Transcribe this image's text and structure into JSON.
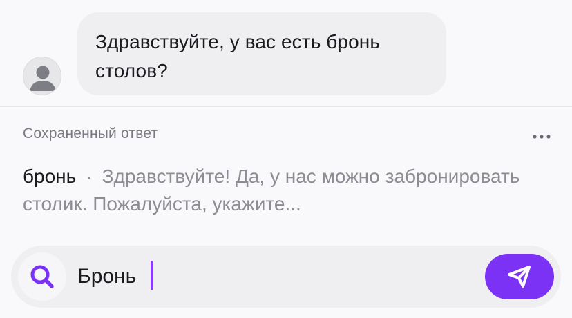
{
  "chat": {
    "incoming_message": "Здравствуйте, у вас есть бронь столов?"
  },
  "saved_replies": {
    "section_title": "Сохраненный ответ",
    "more_icon": "more-horizontal-icon",
    "items": [
      {
        "keyword": "бронь",
        "separator": "·",
        "preview": "Здравствуйте! Да, у нас можно забронировать столик. Пожалуйста, укажите..."
      }
    ]
  },
  "composer": {
    "search_icon": "search-icon",
    "input_value": "Бронь",
    "send_icon": "send-icon",
    "accent_color": "#7b32f5"
  }
}
